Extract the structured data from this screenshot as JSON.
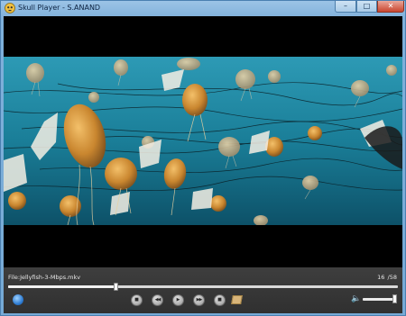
{
  "window": {
    "title": "Skull Player - S.ANAND",
    "minimize_glyph": "–",
    "maximize_glyph": "□",
    "close_glyph": "✕"
  },
  "video": {
    "content": "jellyfish underwater footage"
  },
  "status": {
    "filename": "File:Jellyfish-3-Mbps.mkv",
    "current_time": "16",
    "total_time": "/58"
  },
  "seek": {
    "position": 0.276
  },
  "volume": {
    "level": 0.95
  },
  "controls": {
    "stop_glyph": "■",
    "prev_glyph": "◀◀",
    "play_glyph": "▶",
    "next_glyph": "▶▶",
    "end_glyph": "■",
    "speaker_glyph": "🔈"
  },
  "colors": {
    "window_frame": "#7fb0da",
    "close_button": "#c9452f",
    "water": "#167089",
    "jellyfish": "#c98a3a",
    "control_bg": "#363636"
  }
}
